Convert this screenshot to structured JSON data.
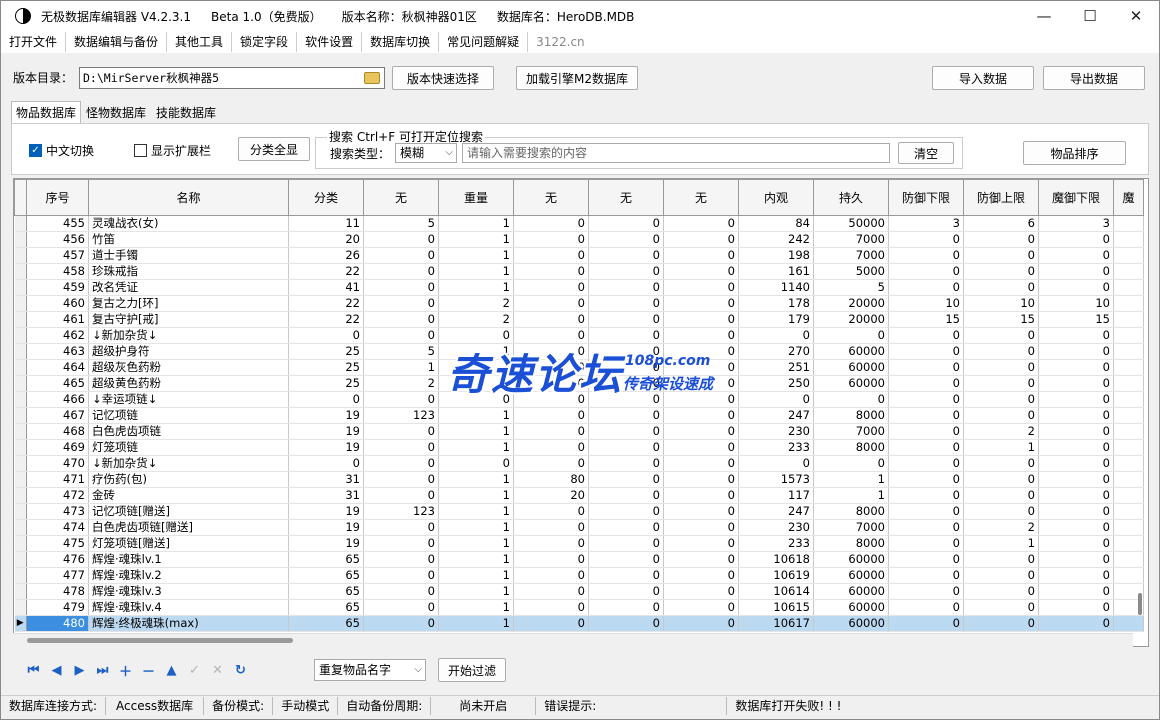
{
  "titlebar": {
    "app_name": "无极数据库编辑器 V4.2.3.1",
    "edition": "Beta 1.0（免费版）",
    "version_name": "版本名称：秋枫神器01区",
    "db_name": "数据库名：HeroDB.MDB",
    "minimize": "—",
    "maximize": "☐",
    "close": "✕"
  },
  "menu": [
    "打开文件",
    "数据编辑与备份",
    "其他工具",
    "锁定字段",
    "软件设置",
    "数据库切换",
    "常见问题解疑",
    "3122.cn"
  ],
  "toolbar": {
    "dir_label": "版本目录：",
    "dir_value": "D:\\MirServer秋枫神器5",
    "quick_select": "版本快速选择",
    "load_engine": "加载引擎M2数据库",
    "import": "导入数据",
    "export": "导出数据"
  },
  "tabs": [
    "物品数据库",
    "怪物数据库",
    "技能数据库"
  ],
  "filters": {
    "chinese_switch": "中文切换",
    "show_ext": "显示扩展栏",
    "all_categories": "分类全显",
    "search_legend": "搜索   Ctrl+F 可打开定位搜索",
    "search_type_label": "搜索类型：",
    "search_type_value": "模糊",
    "search_placeholder": "请输入需要搜索的内容",
    "clear": "清空",
    "sort": "物品排序"
  },
  "columns": [
    "序号",
    "名称",
    "分类",
    "无",
    "重量",
    "无",
    "无",
    "无",
    "内观",
    "持久",
    "防御下限",
    "防御上限",
    "魔御下限",
    "魔"
  ],
  "rows": [
    [
      "455",
      "灵魂战衣(女)",
      "11",
      "5",
      "1",
      "0",
      "0",
      "0",
      "84",
      "50000",
      "3",
      "6",
      "3"
    ],
    [
      "456",
      "竹笛",
      "20",
      "0",
      "1",
      "0",
      "0",
      "0",
      "242",
      "7000",
      "0",
      "0",
      "0"
    ],
    [
      "457",
      "道士手镯",
      "26",
      "0",
      "1",
      "0",
      "0",
      "0",
      "198",
      "7000",
      "0",
      "0",
      "0"
    ],
    [
      "458",
      "珍珠戒指",
      "22",
      "0",
      "1",
      "0",
      "0",
      "0",
      "161",
      "5000",
      "0",
      "0",
      "0"
    ],
    [
      "459",
      "改名凭证",
      "41",
      "0",
      "1",
      "0",
      "0",
      "0",
      "1140",
      "5",
      "0",
      "0",
      "0"
    ],
    [
      "460",
      "复古之力[环]",
      "22",
      "0",
      "2",
      "0",
      "0",
      "0",
      "178",
      "20000",
      "10",
      "10",
      "10"
    ],
    [
      "461",
      "复古守护[戒]",
      "22",
      "0",
      "2",
      "0",
      "0",
      "0",
      "179",
      "20000",
      "15",
      "15",
      "15"
    ],
    [
      "462",
      "↓新加杂货↓",
      "0",
      "0",
      "0",
      "0",
      "0",
      "0",
      "0",
      "0",
      "0",
      "0",
      "0"
    ],
    [
      "463",
      "超级护身符",
      "25",
      "5",
      "1",
      "0",
      "0",
      "0",
      "270",
      "60000",
      "0",
      "0",
      "0"
    ],
    [
      "464",
      "超级灰色药粉",
      "25",
      "1",
      "1",
      "0",
      "0",
      "0",
      "251",
      "60000",
      "0",
      "0",
      "0"
    ],
    [
      "465",
      "超级黄色药粉",
      "25",
      "2",
      "1",
      "0",
      "0",
      "0",
      "250",
      "60000",
      "0",
      "0",
      "0"
    ],
    [
      "466",
      "↓幸运项链↓",
      "0",
      "0",
      "0",
      "0",
      "0",
      "0",
      "0",
      "0",
      "0",
      "0",
      "0"
    ],
    [
      "467",
      "记忆项链",
      "19",
      "123",
      "1",
      "0",
      "0",
      "0",
      "247",
      "8000",
      "0",
      "0",
      "0"
    ],
    [
      "468",
      "白色虎齿项链",
      "19",
      "0",
      "1",
      "0",
      "0",
      "0",
      "230",
      "7000",
      "0",
      "2",
      "0"
    ],
    [
      "469",
      "灯笼项链",
      "19",
      "0",
      "1",
      "0",
      "0",
      "0",
      "233",
      "8000",
      "0",
      "1",
      "0"
    ],
    [
      "470",
      "↓新加杂货↓",
      "0",
      "0",
      "0",
      "0",
      "0",
      "0",
      "0",
      "0",
      "0",
      "0",
      "0"
    ],
    [
      "471",
      "疗伤药(包)",
      "31",
      "0",
      "1",
      "80",
      "0",
      "0",
      "1573",
      "1",
      "0",
      "0",
      "0"
    ],
    [
      "472",
      "金砖",
      "31",
      "0",
      "1",
      "20",
      "0",
      "0",
      "117",
      "1",
      "0",
      "0",
      "0"
    ],
    [
      "473",
      "记忆项链[赠送]",
      "19",
      "123",
      "1",
      "0",
      "0",
      "0",
      "247",
      "8000",
      "0",
      "0",
      "0"
    ],
    [
      "474",
      "白色虎齿项链[赠送]",
      "19",
      "0",
      "1",
      "0",
      "0",
      "0",
      "230",
      "7000",
      "0",
      "2",
      "0"
    ],
    [
      "475",
      "灯笼项链[赠送]",
      "19",
      "0",
      "1",
      "0",
      "0",
      "0",
      "233",
      "8000",
      "0",
      "1",
      "0"
    ],
    [
      "476",
      "辉煌·魂珠lv.1",
      "65",
      "0",
      "1",
      "0",
      "0",
      "0",
      "10618",
      "60000",
      "0",
      "0",
      "0"
    ],
    [
      "477",
      "辉煌·魂珠lv.2",
      "65",
      "0",
      "1",
      "0",
      "0",
      "0",
      "10619",
      "60000",
      "0",
      "0",
      "0"
    ],
    [
      "478",
      "辉煌·魂珠lv.3",
      "65",
      "0",
      "1",
      "0",
      "0",
      "0",
      "10614",
      "60000",
      "0",
      "0",
      "0"
    ],
    [
      "479",
      "辉煌·魂珠lv.4",
      "65",
      "0",
      "1",
      "0",
      "0",
      "0",
      "10615",
      "60000",
      "0",
      "0",
      "0"
    ],
    [
      "480",
      "辉煌·终极魂珠(max)",
      "65",
      "0",
      "1",
      "0",
      "0",
      "0",
      "10617",
      "60000",
      "0",
      "0",
      "0"
    ]
  ],
  "selected_row": "480",
  "bottom": {
    "dup_select": "重复物品名字",
    "filter_btn": "开始过滤"
  },
  "status": [
    "数据库连接方式:",
    "Access数据库",
    "备份模式:",
    "手动模式",
    "自动备份周期:",
    "尚未开启",
    "错误提示:",
    "数据库打开失败! ! !"
  ],
  "watermark": {
    "main": "奇速论坛",
    "url": "108pc.com",
    "sub": "传奇架设速成"
  }
}
